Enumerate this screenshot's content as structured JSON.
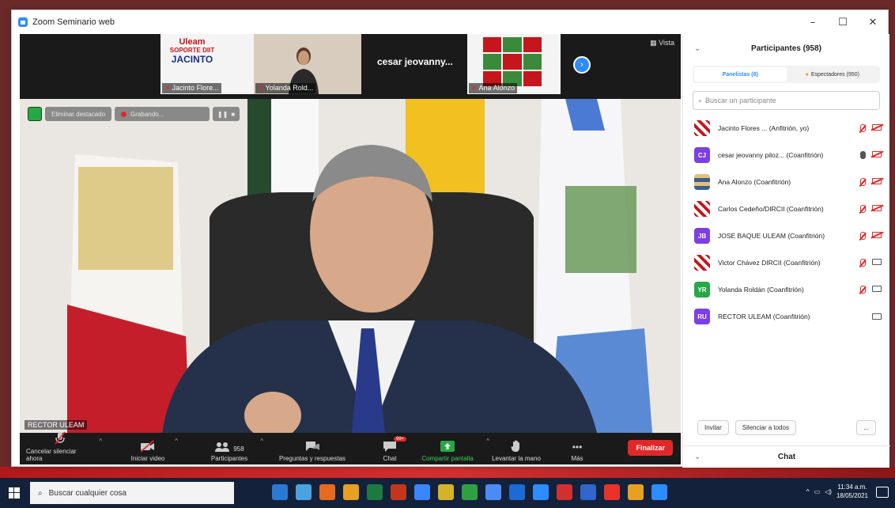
{
  "window": {
    "title": "Zoom Seminario web",
    "controls": [
      "–",
      "☐",
      "✕"
    ]
  },
  "thumbnails": [
    {
      "name": "Jacinto Flore...",
      "logo_lines": [
        "Uleam",
        "SOPORTE DIIT",
        "JACINTO"
      ]
    },
    {
      "name": "Yolanda Rold..."
    },
    {
      "name": "",
      "text": "cesar jeovanny..."
    },
    {
      "name": "Ana Alonzo"
    }
  ],
  "view_label": "Vista",
  "recording": {
    "spotlight_label": "Eliminar destacado",
    "recording_label": "Grabando...",
    "pause": "❚❚",
    "stop": "■"
  },
  "speaker_name": "RECTOR ULEAM",
  "toolbar": {
    "mute": "Cancelar silenciar ahora",
    "video": "Iniciar video",
    "participants": "Participantes",
    "participants_count": "958",
    "qa": "Preguntas y respuestas",
    "chat": "Chat",
    "chat_badge": "99+",
    "share": "Compartir pantalla",
    "raise_hand": "Levantar la mano",
    "more": "Más",
    "end": "Finalizar"
  },
  "panel": {
    "title": "Participantes (958)",
    "tabs": [
      {
        "label": "Panelistas (8)",
        "active": true
      },
      {
        "label": "Espectadores (950)",
        "active": false
      }
    ],
    "search_placeholder": "Buscar un participante",
    "participants": [
      {
        "avatar": "img",
        "initials": "",
        "color": "#c4161c",
        "name": "Jacinto Flores ... (Anfitrión, yo)",
        "mic_on": false,
        "cam_on": false
      },
      {
        "avatar": "initials",
        "initials": "CJ",
        "color": "#7b3fe4",
        "name": "cesar jeovanny piloz... (Coanfitrión)",
        "mic_on": true,
        "cam_on": false
      },
      {
        "avatar": "imgb",
        "initials": "",
        "color": "#3b5e8a",
        "name": "Ana Alonzo (Coanfitrión)",
        "mic_on": false,
        "cam_on": false
      },
      {
        "avatar": "img",
        "initials": "",
        "color": "#c4161c",
        "name": "Carlos Cedeño/DIRCII (Coanfitrión)",
        "mic_on": false,
        "cam_on": false
      },
      {
        "avatar": "initials",
        "initials": "JB",
        "color": "#7b3fe4",
        "name": "JOSE BAQUE ULEAM (Coanfitrión)",
        "mic_on": false,
        "cam_on": false
      },
      {
        "avatar": "img",
        "initials": "",
        "color": "#c4161c",
        "name": "Victor Chávez DIRCII (Coanfitrión)",
        "mic_on": false,
        "cam_on": true
      },
      {
        "avatar": "initials",
        "initials": "YR",
        "color": "#28a745",
        "name": "Yolanda Roldán (Coanfitrión)",
        "mic_on": false,
        "cam_on": true
      },
      {
        "avatar": "initials",
        "initials": "RU",
        "color": "#7b3fe4",
        "name": "RECTOR ULEAM (Coanfitrión)",
        "mic_on": null,
        "cam_on": true
      }
    ],
    "invite": "Invitar",
    "mute_all": "Silenciar a todos",
    "more": "...",
    "chat_header": "Chat"
  },
  "taskbar": {
    "search_placeholder": "Buscar cualquier cosa",
    "time": "11:34 a.m.",
    "date": "18/05/2021",
    "app_colors": [
      "#2a7ad4",
      "#4aa3df",
      "#e66a1f",
      "#e8a020",
      "#1d7a3e",
      "#c4361c",
      "#3a86ff",
      "#d4b22a",
      "#2ea043",
      "#4b8bf5",
      "#1b6ad6",
      "#2d8cff",
      "#d23030",
      "#3366cc",
      "#e8332a",
      "#e8a020",
      "#2d8cff"
    ]
  }
}
